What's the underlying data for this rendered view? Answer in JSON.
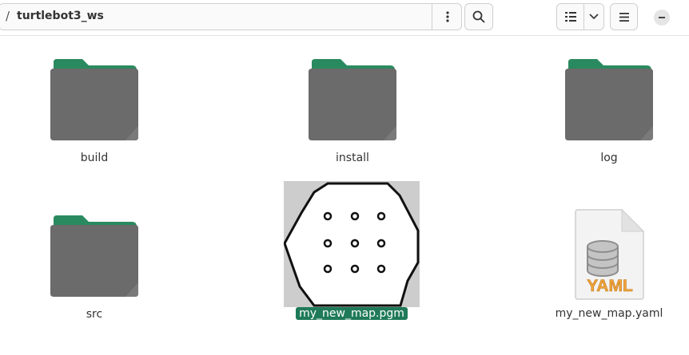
{
  "header": {
    "path_separator": "/",
    "current_folder": "turtlebot3_ws"
  },
  "files": [
    {
      "name": "build",
      "type": "folder"
    },
    {
      "name": "install",
      "type": "folder"
    },
    {
      "name": "log",
      "type": "folder"
    },
    {
      "name": "src",
      "type": "folder"
    },
    {
      "name": "my_new_map.pgm",
      "type": "image",
      "selected": true
    },
    {
      "name": "my_new_map.yaml",
      "type": "yaml",
      "badge": "YAML"
    }
  ],
  "colors": {
    "folder_tab": "#2a8a5f",
    "folder_body": "#6b6b6b",
    "selection": "#1f7a59",
    "yaml_badge": "#f0a43a"
  }
}
